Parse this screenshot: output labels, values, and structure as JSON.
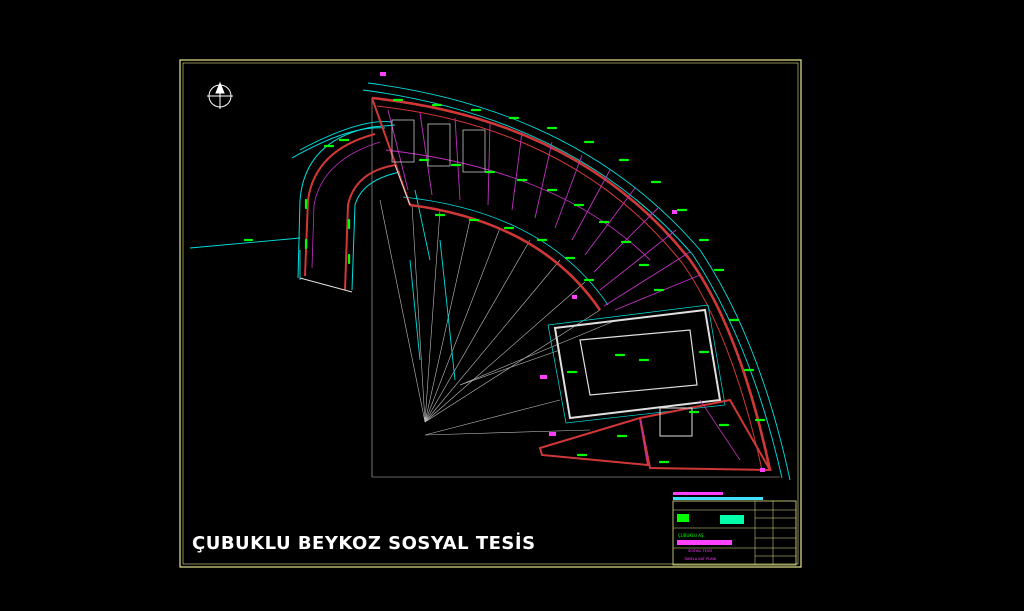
{
  "drawing": {
    "caption": "ÇUBUKLU BEYKOZ SOSYAL TESİS",
    "colors": {
      "background": "#000000",
      "frame": "#e6e68c",
      "wall": "#d03838",
      "partition": "#c030c0",
      "dimension": "#00e0e0",
      "annotation": "#00ff00",
      "construction": "#e0e0e0",
      "titleblock_bar": "#ff40ff"
    },
    "icons": [
      "north-arrow-icon"
    ]
  },
  "title_block": {
    "project_label": "ÇUBUKLU AŞ.",
    "sheet_label": "SOSYAL TESİS",
    "sheet_sub": "TABELA KAT PLANI"
  }
}
